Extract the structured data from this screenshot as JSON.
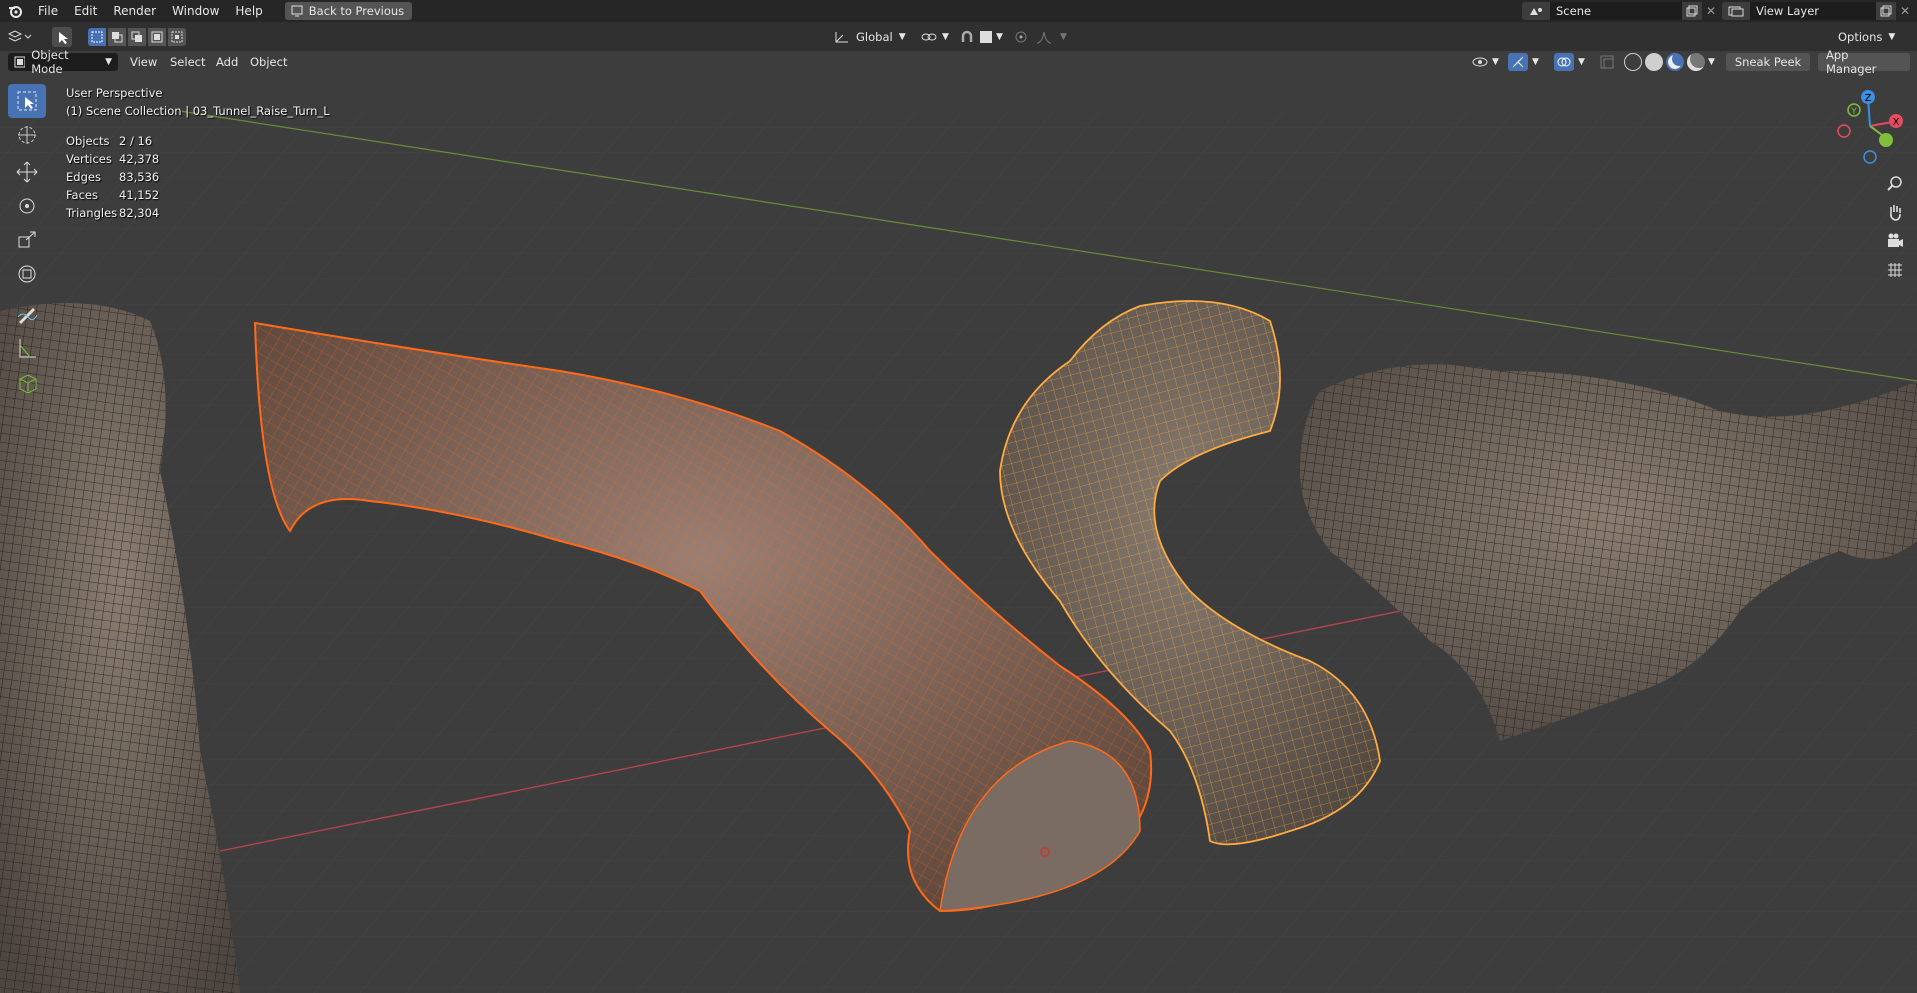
{
  "menubar": {
    "items": [
      "File",
      "Edit",
      "Render",
      "Window",
      "Help"
    ],
    "back_button": "Back to Previous",
    "scene_label": "Scene",
    "view_layer_label": "View Layer"
  },
  "header": {
    "transform_orientation": "Global",
    "options_label": "Options"
  },
  "viewport_header": {
    "mode": "Object Mode",
    "menus": [
      "View",
      "Select",
      "Add",
      "Object"
    ],
    "sneak_peek": "Sneak Peek",
    "app_manager": "App Manager"
  },
  "overlay": {
    "perspective": "User Perspective",
    "collection": "(1) Scene Collection | 03_Tunnel_Raise_Turn_L",
    "stats": [
      {
        "label": "Objects",
        "value": "2 / 16"
      },
      {
        "label": "Vertices",
        "value": "42,378"
      },
      {
        "label": "Edges",
        "value": "83,536"
      },
      {
        "label": "Faces",
        "value": "41,152"
      },
      {
        "label": "Triangles",
        "value": "82,304"
      }
    ]
  },
  "gizmo": {
    "x": "X",
    "y": "Y",
    "z": "Z"
  },
  "colors": {
    "accent": "#4772b3",
    "selected_active": "#ff7a1f",
    "selected": "#ffa53a",
    "x_axis": "#e84a5f",
    "y_axis": "#7fbf3c",
    "z_axis": "#3d8fe0"
  }
}
